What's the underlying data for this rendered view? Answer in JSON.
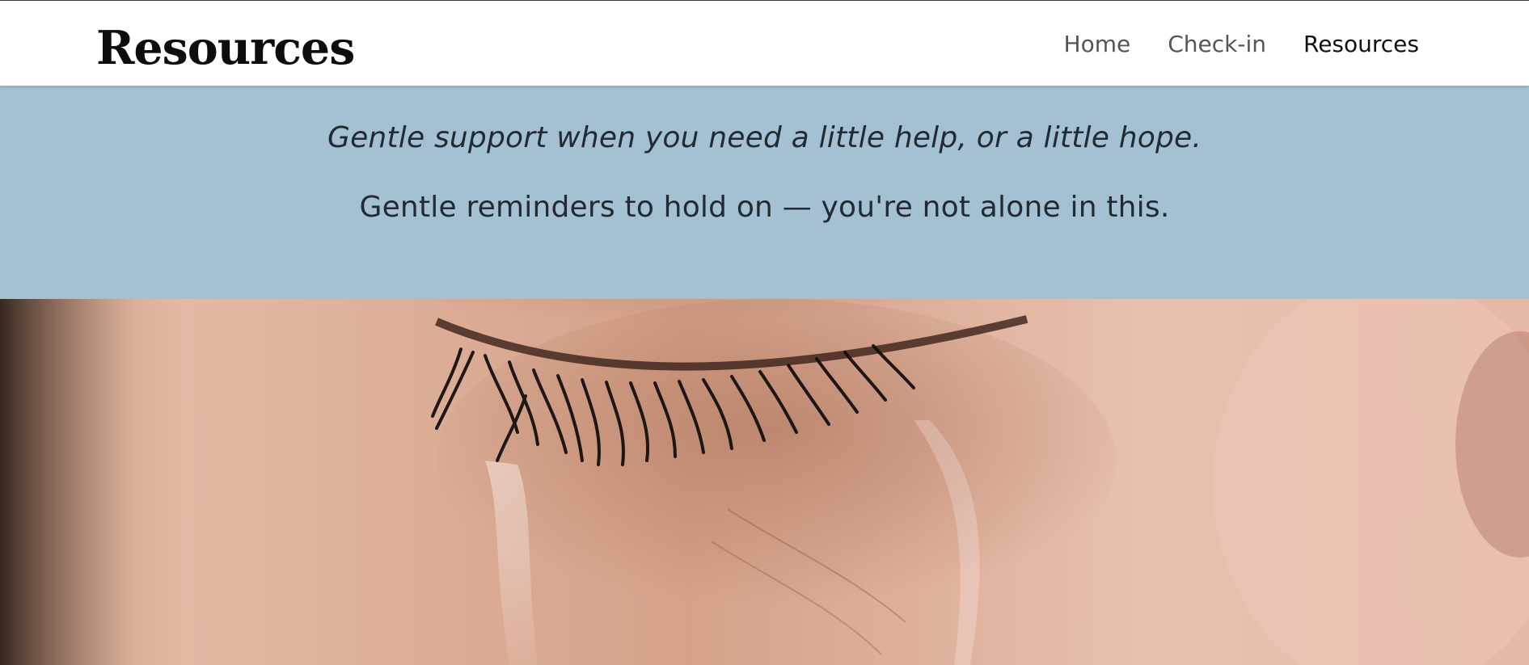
{
  "header": {
    "brand_title": "Resources",
    "nav": [
      {
        "label": "Home",
        "active": false
      },
      {
        "label": "Check-in",
        "active": false
      },
      {
        "label": "Resources",
        "active": true
      }
    ]
  },
  "hero": {
    "tagline": "Gentle support when you need a little help, or a little hope.",
    "reminder": "Gentle reminders to hold on — you're not alone in this."
  },
  "image": {
    "name": "crying-eye-photo"
  },
  "colors": {
    "banner_bg": "#a3c1d3",
    "text_dark": "#222a33",
    "nav_text": "#555555"
  }
}
